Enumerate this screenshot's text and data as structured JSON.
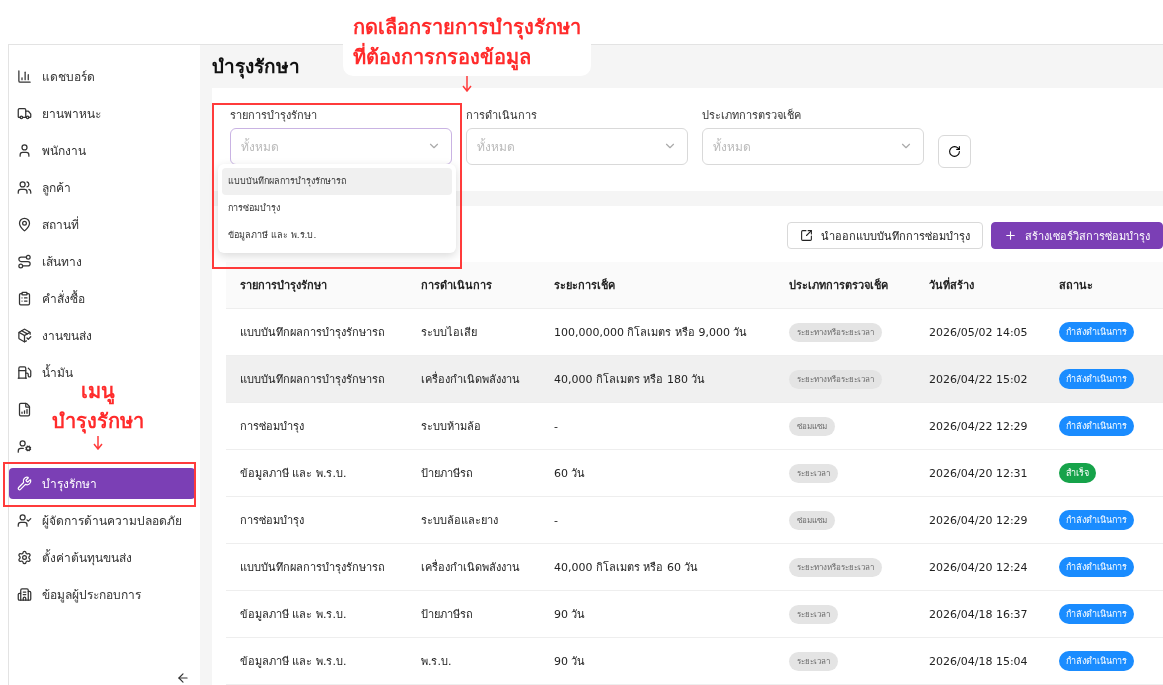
{
  "sidebar": {
    "items": [
      {
        "label": "แดชบอร์ด",
        "selected": false
      },
      {
        "label": "ยานพาหนะ",
        "selected": false
      },
      {
        "label": "พนักงาน",
        "selected": false
      },
      {
        "label": "ลูกค้า",
        "selected": false
      },
      {
        "label": "สถานที่",
        "selected": false
      },
      {
        "label": "เส้นทาง",
        "selected": false
      },
      {
        "label": "คำสั่งซื้อ",
        "selected": false
      },
      {
        "label": "งานขนส่ง",
        "selected": false
      },
      {
        "label": "น้ำมัน",
        "selected": false
      },
      {
        "selected": false
      },
      {
        "selected": false
      },
      {
        "label": "บำรุงรักษา",
        "selected": true
      },
      {
        "label": "ผู้จัดการด้านความปลอดภัย",
        "selected": false
      },
      {
        "label": "ตั้งค่าต้นทุนขนส่ง",
        "selected": false
      },
      {
        "label": "ข้อมูลผู้ประกอบการ",
        "selected": false
      }
    ]
  },
  "page_title": "บำรุงรักษา",
  "filters": [
    {
      "label": "รายการบำรุงรักษา",
      "placeholder": "ทั้งหมด",
      "expanded": true,
      "options": [
        {
          "label": "แบบบันทึกผลการบำรุงรักษารถ",
          "highlighted": true
        },
        {
          "label": "การซ่อมบำรุง",
          "highlighted": false
        },
        {
          "label": "ข้อมูลภาษี และ พ.ร.บ.",
          "highlighted": false
        }
      ]
    },
    {
      "label": "การดำเนินการ",
      "placeholder": "ทั้งหมด",
      "expanded": false
    },
    {
      "label": "ประเภทการตรวจเช็ค",
      "placeholder": "ทั้งหมด",
      "expanded": false
    }
  ],
  "actions": [
    {
      "kind": "export",
      "label": "นำออกแบบบันทึกการซ่อมบำรุง"
    },
    {
      "kind": "create",
      "label": "สร้างเซอร์วิสการซ่อมบำรุง"
    }
  ],
  "table": {
    "columns": [
      "รายการบำรุงรักษา",
      "การดำเนินการ",
      "ระยะการเช็ค",
      "ประเภทการตรวจเช็ค",
      "วันที่สร้าง",
      "สถานะ"
    ],
    "rows": [
      {
        "item": "แบบบันทึกผลการบำรุงรักษารถ",
        "operation": "ระบบไอเสีย",
        "interval": "100,000,000 กิโลเมตร หรือ 9,000 วัน",
        "check_type": "ระยะทางหรือระยะเวลา",
        "created": "2026/05/02 14:05",
        "status": {
          "label": "กำลังดำเนินการ",
          "color": "#1a8cff"
        },
        "highlighted": false
      },
      {
        "item": "แบบบันทึกผลการบำรุงรักษารถ",
        "operation": "เครื่องกำเนิดพลังงาน",
        "interval": "40,000 กิโลเมตร หรือ 180 วัน",
        "check_type": "ระยะทางหรือระยะเวลา",
        "created": "2026/04/22 15:02",
        "status": {
          "label": "กำลังดำเนินการ",
          "color": "#1a8cff"
        },
        "highlighted": true
      },
      {
        "item": "การซ่อมบำรุง",
        "operation": "ระบบห้ามล้อ",
        "interval": "-",
        "check_type": "ซ่อมแซม",
        "created": "2026/04/22 12:29",
        "status": {
          "label": "กำลังดำเนินการ",
          "color": "#1a8cff"
        },
        "highlighted": false
      },
      {
        "item": "ข้อมูลภาษี และ พ.ร.บ.",
        "operation": "ป้ายภาษีรถ",
        "interval": "60 วัน",
        "check_type": "ระยะเวลา",
        "created": "2026/04/20 12:31",
        "status": {
          "label": "สำเร็จ",
          "color": "#16a34a"
        },
        "highlighted": false
      },
      {
        "item": "การซ่อมบำรุง",
        "operation": "ระบบล้อและยาง",
        "interval": "-",
        "check_type": "ซ่อมแซม",
        "created": "2026/04/20 12:29",
        "status": {
          "label": "กำลังดำเนินการ",
          "color": "#1a8cff"
        },
        "highlighted": false
      },
      {
        "item": "แบบบันทึกผลการบำรุงรักษารถ",
        "operation": "เครื่องกำเนิดพลังงาน",
        "interval": "40,000 กิโลเมตร หรือ 60 วัน",
        "check_type": "ระยะทางหรือระยะเวลา",
        "created": "2026/04/20 12:24",
        "status": {
          "label": "กำลังดำเนินการ",
          "color": "#1a8cff"
        },
        "highlighted": false
      },
      {
        "item": "ข้อมูลภาษี และ พ.ร.บ.",
        "operation": "ป้ายภาษีรถ",
        "interval": "90 วัน",
        "check_type": "ระยะเวลา",
        "created": "2026/04/18 16:37",
        "status": {
          "label": "กำลังดำเนินการ",
          "color": "#1a8cff"
        },
        "highlighted": false
      },
      {
        "item": "ข้อมูลภาษี และ พ.ร.บ.",
        "operation": "พ.ร.บ.",
        "interval": "90 วัน",
        "check_type": "ระยะเวลา",
        "created": "2026/04/18 15:04",
        "status": {
          "label": "กำลังดำเนินการ",
          "color": "#1a8cff"
        },
        "highlighted": false
      }
    ]
  },
  "annotations": [
    {
      "kind": "filter",
      "lines": [
        "กดเลือกรายการบำรุงรักษา",
        "ที่ต้องการกรองข้อมูล"
      ]
    },
    {
      "kind": "menu",
      "lines": [
        "เมนู",
        "บำรุงรักษา"
      ]
    }
  ]
}
